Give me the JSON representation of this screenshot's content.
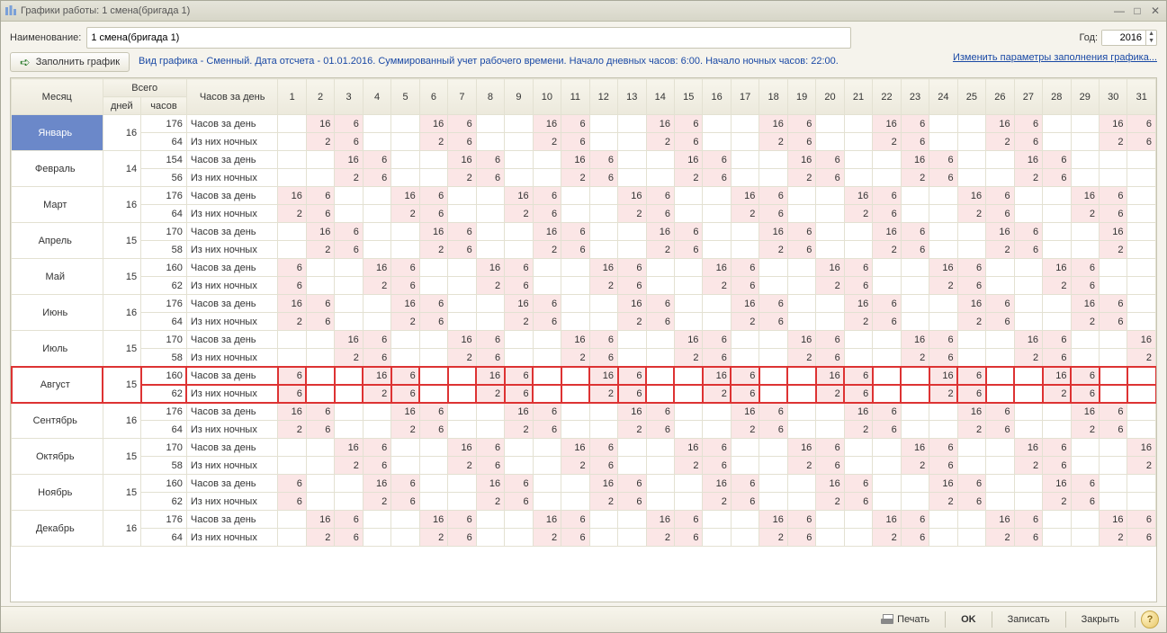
{
  "window": {
    "title": "Графики работы: 1 смена(бригада 1)"
  },
  "labels": {
    "name": "Наименование:",
    "year": "Год:",
    "fill": "Заполнить график",
    "change_link": "Изменить параметры заполнения графика...",
    "print": "Печать",
    "ok": "OK",
    "save": "Записать",
    "close": "Закрыть",
    "month": "Месяц",
    "total": "Всего",
    "days": "дней",
    "hours": "часов",
    "hours_per_day": "Часов за день",
    "row_day": "Часов за день",
    "row_night": "Из них ночных"
  },
  "form": {
    "name": "1 смена(бригада 1)",
    "year": "2016",
    "info": "Вид графика - Сменный. Дата отсчета - 01.01.2016. Суммированный учет рабочего времени. Начало дневных часов: 6:00. Начало ночных часов: 22:00."
  },
  "highlight_month": "Август",
  "selected_month": "Январь",
  "months": [
    {
      "name": "Январь",
      "days": 16,
      "hours": 176,
      "night_total": 64,
      "start": 2,
      "day": [
        null,
        16,
        6,
        null,
        null,
        16,
        6,
        null,
        null,
        16,
        6,
        null,
        null,
        16,
        6,
        null,
        null,
        16,
        6,
        null,
        null,
        16,
        6,
        null,
        null,
        16,
        6,
        null,
        null,
        16,
        6
      ],
      "night": [
        null,
        2,
        6,
        null,
        null,
        2,
        6,
        null,
        null,
        2,
        6,
        null,
        null,
        2,
        6,
        null,
        null,
        2,
        6,
        null,
        null,
        2,
        6,
        null,
        null,
        2,
        6,
        null,
        null,
        2,
        6
      ]
    },
    {
      "name": "Февраль",
      "days": 14,
      "hours": 154,
      "night_total": 56,
      "start": 3,
      "day": [
        null,
        null,
        16,
        6,
        null,
        null,
        16,
        6,
        null,
        null,
        16,
        6,
        null,
        null,
        16,
        6,
        null,
        null,
        16,
        6,
        null,
        null,
        16,
        6,
        null,
        null,
        16,
        6,
        null,
        null,
        null
      ],
      "night": [
        null,
        null,
        2,
        6,
        null,
        null,
        2,
        6,
        null,
        null,
        2,
        6,
        null,
        null,
        2,
        6,
        null,
        null,
        2,
        6,
        null,
        null,
        2,
        6,
        null,
        null,
        2,
        6,
        null,
        null,
        null
      ]
    },
    {
      "name": "Март",
      "days": 16,
      "hours": 176,
      "night_total": 64,
      "start": 1,
      "day": [
        16,
        6,
        null,
        null,
        16,
        6,
        null,
        null,
        16,
        6,
        null,
        null,
        16,
        6,
        null,
        null,
        16,
        6,
        null,
        null,
        16,
        6,
        null,
        null,
        16,
        6,
        null,
        null,
        16,
        6,
        null
      ],
      "night": [
        2,
        6,
        null,
        null,
        2,
        6,
        null,
        null,
        2,
        6,
        null,
        null,
        2,
        6,
        null,
        null,
        2,
        6,
        null,
        null,
        2,
        6,
        null,
        null,
        2,
        6,
        null,
        null,
        2,
        6,
        null
      ]
    },
    {
      "name": "Апрель",
      "days": 15,
      "hours": 170,
      "night_total": 58,
      "start": 2,
      "day": [
        null,
        16,
        6,
        null,
        null,
        16,
        6,
        null,
        null,
        16,
        6,
        null,
        null,
        16,
        6,
        null,
        null,
        16,
        6,
        null,
        null,
        16,
        6,
        null,
        null,
        16,
        6,
        null,
        null,
        16,
        null
      ],
      "night": [
        null,
        2,
        6,
        null,
        null,
        2,
        6,
        null,
        null,
        2,
        6,
        null,
        null,
        2,
        6,
        null,
        null,
        2,
        6,
        null,
        null,
        2,
        6,
        null,
        null,
        2,
        6,
        null,
        null,
        2,
        null
      ]
    },
    {
      "name": "Май",
      "days": 15,
      "hours": 160,
      "night_total": 62,
      "start": 1,
      "day": [
        6,
        null,
        null,
        16,
        6,
        null,
        null,
        16,
        6,
        null,
        null,
        16,
        6,
        null,
        null,
        16,
        6,
        null,
        null,
        16,
        6,
        null,
        null,
        16,
        6,
        null,
        null,
        16,
        6,
        null,
        null
      ],
      "night": [
        6,
        null,
        null,
        2,
        6,
        null,
        null,
        2,
        6,
        null,
        null,
        2,
        6,
        null,
        null,
        2,
        6,
        null,
        null,
        2,
        6,
        null,
        null,
        2,
        6,
        null,
        null,
        2,
        6,
        null,
        null
      ]
    },
    {
      "name": "Июнь",
      "days": 16,
      "hours": 176,
      "night_total": 64,
      "start": 1,
      "day": [
        16,
        6,
        null,
        null,
        16,
        6,
        null,
        null,
        16,
        6,
        null,
        null,
        16,
        6,
        null,
        null,
        16,
        6,
        null,
        null,
        16,
        6,
        null,
        null,
        16,
        6,
        null,
        null,
        16,
        6,
        null
      ],
      "night": [
        2,
        6,
        null,
        null,
        2,
        6,
        null,
        null,
        2,
        6,
        null,
        null,
        2,
        6,
        null,
        null,
        2,
        6,
        null,
        null,
        2,
        6,
        null,
        null,
        2,
        6,
        null,
        null,
        2,
        6,
        null
      ]
    },
    {
      "name": "Июль",
      "days": 15,
      "hours": 170,
      "night_total": 58,
      "start": 3,
      "day": [
        null,
        null,
        16,
        6,
        null,
        null,
        16,
        6,
        null,
        null,
        16,
        6,
        null,
        null,
        16,
        6,
        null,
        null,
        16,
        6,
        null,
        null,
        16,
        6,
        null,
        null,
        16,
        6,
        null,
        null,
        16
      ],
      "night": [
        null,
        null,
        2,
        6,
        null,
        null,
        2,
        6,
        null,
        null,
        2,
        6,
        null,
        null,
        2,
        6,
        null,
        null,
        2,
        6,
        null,
        null,
        2,
        6,
        null,
        null,
        2,
        6,
        null,
        null,
        2
      ]
    },
    {
      "name": "Август",
      "days": 15,
      "hours": 160,
      "night_total": 62,
      "start": 1,
      "day": [
        6,
        null,
        null,
        16,
        6,
        null,
        null,
        16,
        6,
        null,
        null,
        16,
        6,
        null,
        null,
        16,
        6,
        null,
        null,
        16,
        6,
        null,
        null,
        16,
        6,
        null,
        null,
        16,
        6,
        null,
        null
      ],
      "night": [
        6,
        null,
        null,
        2,
        6,
        null,
        null,
        2,
        6,
        null,
        null,
        2,
        6,
        null,
        null,
        2,
        6,
        null,
        null,
        2,
        6,
        null,
        null,
        2,
        6,
        null,
        null,
        2,
        6,
        null,
        null
      ]
    },
    {
      "name": "Сентябрь",
      "days": 16,
      "hours": 176,
      "night_total": 64,
      "start": 1,
      "day": [
        16,
        6,
        null,
        null,
        16,
        6,
        null,
        null,
        16,
        6,
        null,
        null,
        16,
        6,
        null,
        null,
        16,
        6,
        null,
        null,
        16,
        6,
        null,
        null,
        16,
        6,
        null,
        null,
        16,
        6,
        null
      ],
      "night": [
        2,
        6,
        null,
        null,
        2,
        6,
        null,
        null,
        2,
        6,
        null,
        null,
        2,
        6,
        null,
        null,
        2,
        6,
        null,
        null,
        2,
        6,
        null,
        null,
        2,
        6,
        null,
        null,
        2,
        6,
        null
      ]
    },
    {
      "name": "Октябрь",
      "days": 15,
      "hours": 170,
      "night_total": 58,
      "start": 3,
      "day": [
        null,
        null,
        16,
        6,
        null,
        null,
        16,
        6,
        null,
        null,
        16,
        6,
        null,
        null,
        16,
        6,
        null,
        null,
        16,
        6,
        null,
        null,
        16,
        6,
        null,
        null,
        16,
        6,
        null,
        null,
        16
      ],
      "night": [
        null,
        null,
        2,
        6,
        null,
        null,
        2,
        6,
        null,
        null,
        2,
        6,
        null,
        null,
        2,
        6,
        null,
        null,
        2,
        6,
        null,
        null,
        2,
        6,
        null,
        null,
        2,
        6,
        null,
        null,
        2
      ]
    },
    {
      "name": "Ноябрь",
      "days": 15,
      "hours": 160,
      "night_total": 62,
      "start": 1,
      "day": [
        6,
        null,
        null,
        16,
        6,
        null,
        null,
        16,
        6,
        null,
        null,
        16,
        6,
        null,
        null,
        16,
        6,
        null,
        null,
        16,
        6,
        null,
        null,
        16,
        6,
        null,
        null,
        16,
        6,
        null,
        null
      ],
      "night": [
        6,
        null,
        null,
        2,
        6,
        null,
        null,
        2,
        6,
        null,
        null,
        2,
        6,
        null,
        null,
        2,
        6,
        null,
        null,
        2,
        6,
        null,
        null,
        2,
        6,
        null,
        null,
        2,
        6,
        null,
        null
      ]
    },
    {
      "name": "Декабрь",
      "days": 16,
      "hours": 176,
      "night_total": 64,
      "start": 2,
      "day": [
        null,
        16,
        6,
        null,
        null,
        16,
        6,
        null,
        null,
        16,
        6,
        null,
        null,
        16,
        6,
        null,
        null,
        16,
        6,
        null,
        null,
        16,
        6,
        null,
        null,
        16,
        6,
        null,
        null,
        16,
        6
      ],
      "night": [
        null,
        2,
        6,
        null,
        null,
        2,
        6,
        null,
        null,
        2,
        6,
        null,
        null,
        2,
        6,
        null,
        null,
        2,
        6,
        null,
        null,
        2,
        6,
        null,
        null,
        2,
        6,
        null,
        null,
        2,
        6
      ]
    }
  ]
}
